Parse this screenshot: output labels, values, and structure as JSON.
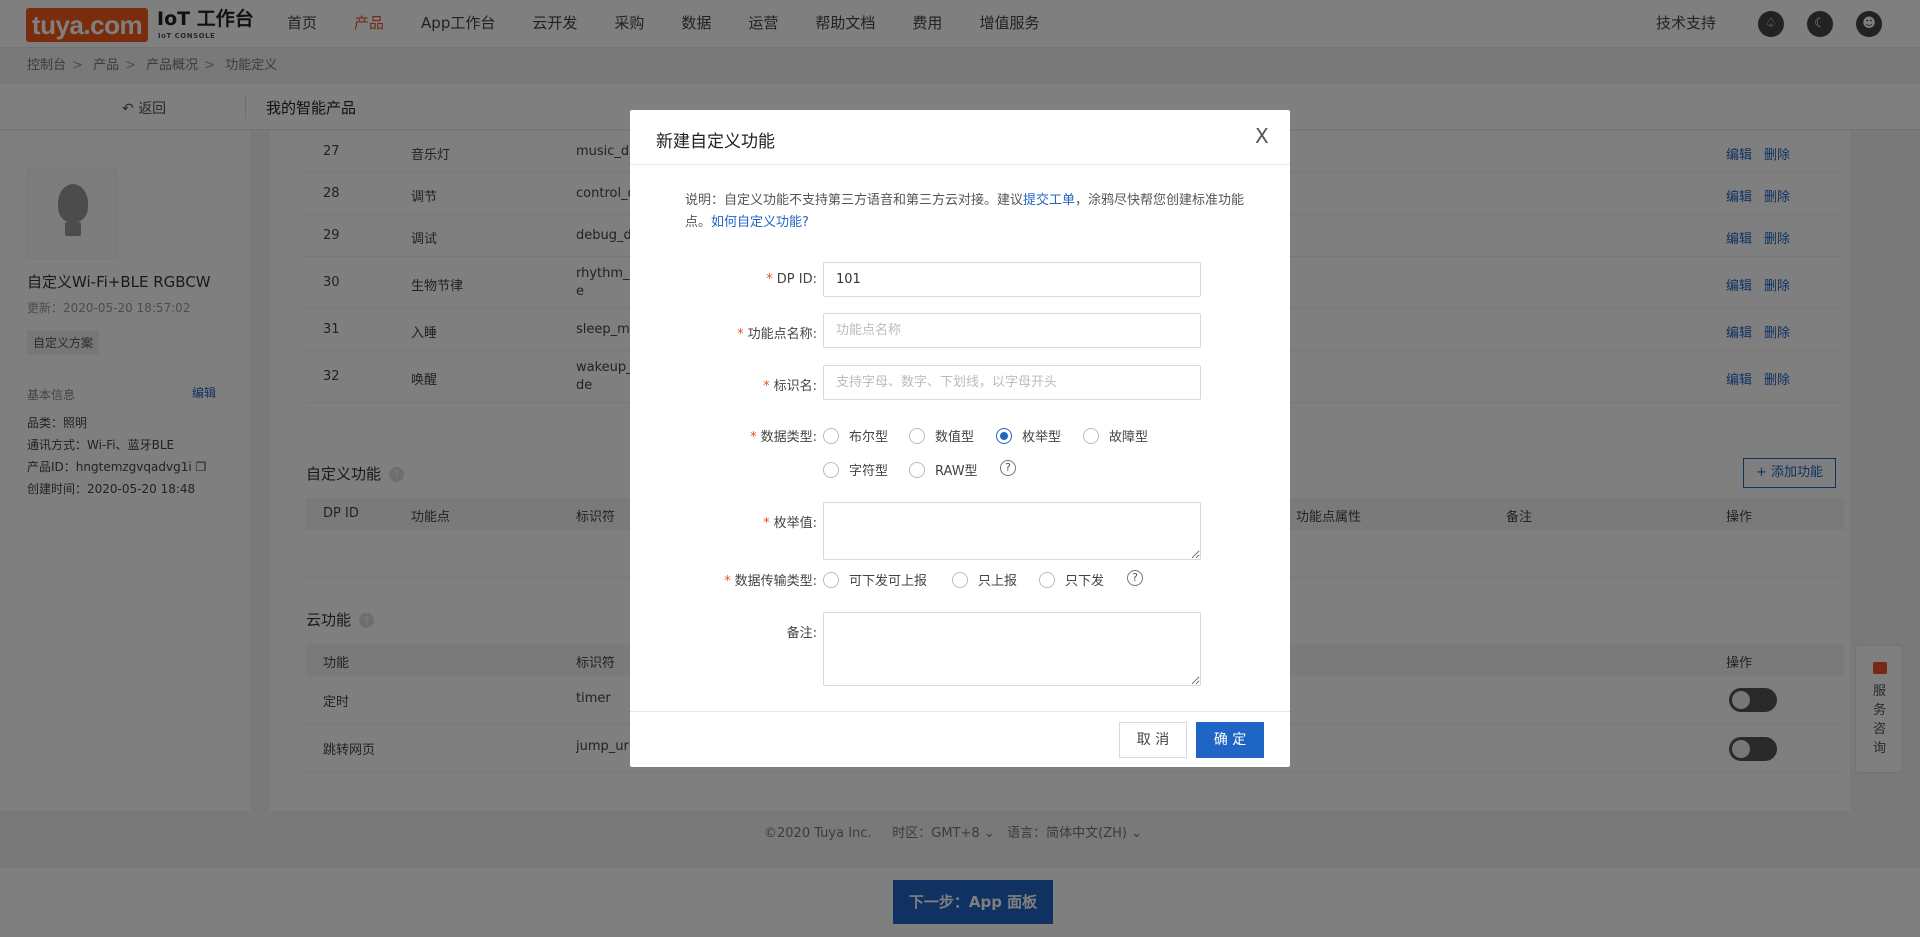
{
  "header": {
    "logo": "tuya.com",
    "title": "IoT 工作台",
    "subtitle": "IoT CONSOLE",
    "nav": [
      "首页",
      "产品",
      "App工作台",
      "云开发",
      "采购",
      "数据",
      "运营",
      "帮助文档",
      "费用",
      "增值服务"
    ],
    "active_nav": "产品",
    "tech_support": "技术支持",
    "icons": [
      "bell-icon",
      "planet-icon",
      "user-icon"
    ]
  },
  "breadcrumb": [
    "控制台",
    "产品",
    "产品概况",
    "功能定义"
  ],
  "backbar": {
    "back_label": "返回",
    "my_products": "我的智能产品"
  },
  "product": {
    "name": "自定义Wi-Fi+BLE RGBCW",
    "updated": "更新：2020-05-20 18:57:02",
    "tag": "自定义方案",
    "basic_info_title": "基本信息",
    "edit": "编辑",
    "category": "品类：照明",
    "comm": "通讯方式：Wi-Fi、蓝牙BLE",
    "pid": "产品ID：hngtemzgvqadvg1i",
    "created": "创建时间：2020-05-20 18:48"
  },
  "std_rows": [
    {
      "id": "27",
      "name": "音乐灯",
      "code": "music_da"
    },
    {
      "id": "28",
      "name": "调节",
      "code": "control_d"
    },
    {
      "id": "29",
      "name": "调试",
      "code": "debug_da"
    },
    {
      "id": "30",
      "name": "生物节律",
      "code": "rhythm_m",
      "code2": "e"
    },
    {
      "id": "31",
      "name": "入睡",
      "code": "sleep_mo"
    },
    {
      "id": "32",
      "name": "唤醒",
      "code": "wakeup_r",
      "code2": "de"
    }
  ],
  "row_ops": {
    "edit": "编辑",
    "delete": "删除"
  },
  "custom": {
    "title": "自定义功能",
    "add_btn": "+ 添加功能",
    "cols": {
      "id": "DP ID",
      "name": "功能点",
      "code": "标识符",
      "attr": "功能点属性",
      "remark": "备注",
      "ops": "操作"
    }
  },
  "cloud": {
    "title": "云功能",
    "cols": {
      "func": "功能",
      "code": "标识符",
      "ops": "操作"
    },
    "rows": [
      {
        "name": "定时",
        "code": "timer"
      },
      {
        "name": "跳转网页",
        "code": "jump_url"
      }
    ]
  },
  "footer": {
    "copyright": "©2020 Tuya Inc.",
    "tz_label": "时区：",
    "tz": "GMT+8",
    "lang_label": "语言：",
    "lang": "简体中文(ZH)"
  },
  "next_btn": "下一步：App 面板",
  "float": {
    "text": "服务咨询"
  },
  "modal": {
    "title": "新建自定义功能",
    "close": "X",
    "desc_1": "说明：自定义功能不支持第三方语音和第三方云对接。建议",
    "desc_link1": "提交工单",
    "desc_2": "，涂鸦尽快帮您创建标准功能点。",
    "desc_link2": "如何自定义功能?",
    "dp_label": "DP ID:",
    "dp_value": "101",
    "name_label": "功能点名称:",
    "name_placeholder": "功能点名称",
    "code_label": "标识名:",
    "code_placeholder": "支持字母、数字、下划线，以字母开头",
    "type_label": "数据类型:",
    "types": [
      "布尔型",
      "数值型",
      "枚举型",
      "故障型",
      "字符型",
      "RAW型"
    ],
    "type_selected": "枚举型",
    "enum_label": "枚举值:",
    "trans_label": "数据传输类型:",
    "trans": [
      "可下发可上报",
      "只上报",
      "只下发"
    ],
    "remark_label": "备注:",
    "cancel": "取 消",
    "ok": "确 定"
  }
}
